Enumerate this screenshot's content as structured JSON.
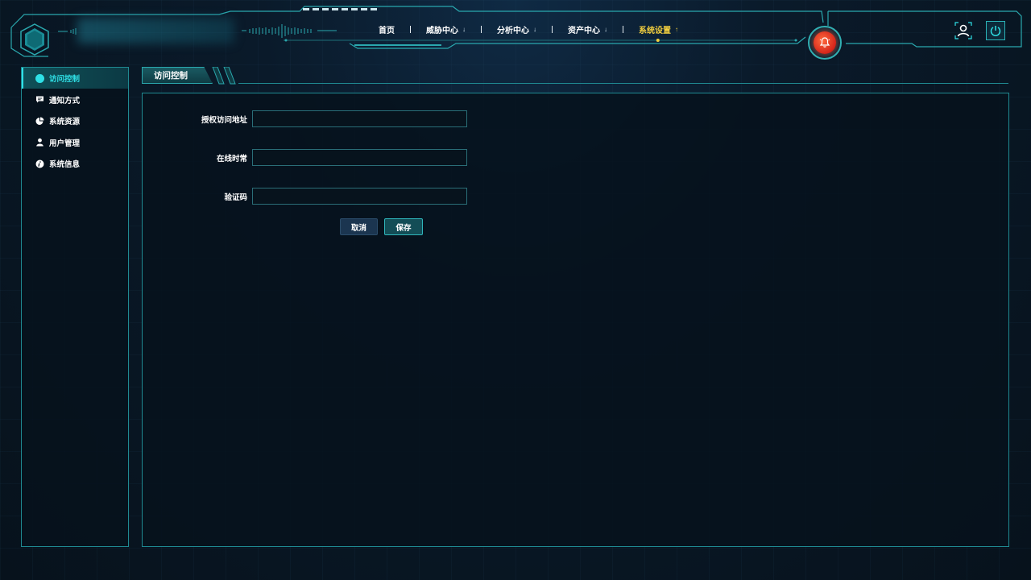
{
  "header": {
    "nav": [
      {
        "label": "首页",
        "has_chevron": false,
        "active": false
      },
      {
        "label": "威胁中心",
        "has_chevron": true,
        "chevron": "↓",
        "active": false
      },
      {
        "label": "分析中心",
        "has_chevron": true,
        "chevron": "↓",
        "active": false
      },
      {
        "label": "资产中心",
        "has_chevron": true,
        "chevron": "↓",
        "active": false
      },
      {
        "label": "系统设置",
        "has_chevron": true,
        "chevron": "↑",
        "active": true
      }
    ],
    "icons": {
      "alarm": "alarm-bell-icon",
      "user": "user-icon",
      "power": "power-icon",
      "logo": "logo-hexagon-icon"
    }
  },
  "sidebar": {
    "items": [
      {
        "label": "访问控制",
        "icon": "dashboard-icon",
        "active": true
      },
      {
        "label": "通知方式",
        "icon": "message-icon",
        "active": false
      },
      {
        "label": "系统资源",
        "icon": "pie-chart-icon",
        "active": false
      },
      {
        "label": "用户管理",
        "icon": "user-icon",
        "active": false
      },
      {
        "label": "系统信息",
        "icon": "info-icon",
        "active": false
      }
    ]
  },
  "main": {
    "title": "访问控制",
    "form": {
      "fields": [
        {
          "label": "授权访问地址",
          "value": "",
          "placeholder": ""
        },
        {
          "label": "在线时常",
          "value": "",
          "placeholder": ""
        },
        {
          "label": "验证码",
          "value": "",
          "placeholder": ""
        }
      ],
      "cancel_label": "取消",
      "save_label": "保存"
    }
  },
  "colors": {
    "accent": "#2fe0e6",
    "border": "#1f8a92",
    "active_nav": "#f4d03f",
    "alarm": "#d4241a",
    "background": "#07121c"
  }
}
